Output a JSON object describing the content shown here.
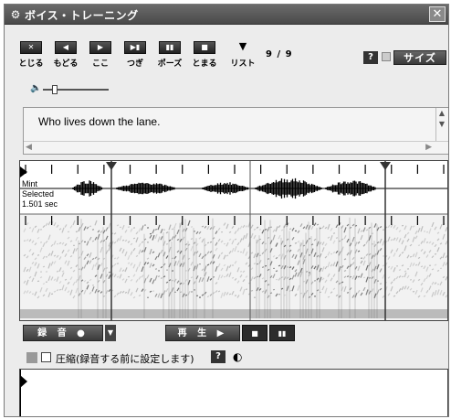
{
  "window": {
    "title": "ボイス・トレーニング",
    "app_icon": "gear-icon",
    "close_icon": "close-icon"
  },
  "toolbar": {
    "buttons": [
      {
        "label": "とじる",
        "icon": "close-x-icon",
        "glyph": "✕"
      },
      {
        "label": "もどる",
        "icon": "back-icon",
        "glyph": "◀"
      },
      {
        "label": "ここ",
        "icon": "play-here-icon",
        "glyph": "▶"
      },
      {
        "label": "つぎ",
        "icon": "next-icon",
        "glyph": "▶▮"
      },
      {
        "label": "ポーズ",
        "icon": "pause-icon",
        "glyph": "▮▮"
      },
      {
        "label": "とまる",
        "icon": "stop-icon",
        "glyph": "■"
      },
      {
        "label": "リスト",
        "icon": "list-icon",
        "glyph": "▼"
      }
    ],
    "counter": "9 / 9",
    "help_label": "?",
    "size_label": "サイズ"
  },
  "volume": {
    "icon": "speaker-icon",
    "level": 0.15
  },
  "sentence": {
    "text": "Who lives down the lane."
  },
  "waveform": {
    "label_name": "Mint",
    "label_status": "Selected",
    "duration": "1.501 sec",
    "tick_count": 17
  },
  "controls": {
    "record_label": "録 音 ●",
    "record_dropdown": "▼",
    "play_label": "再 生 ▶",
    "stop_glyph": "■",
    "pause_glyph": "▮▮"
  },
  "compress": {
    "label": "圧縮(録音する前に設定します)",
    "help_label": "?",
    "globe_icon": "globe-icon"
  }
}
